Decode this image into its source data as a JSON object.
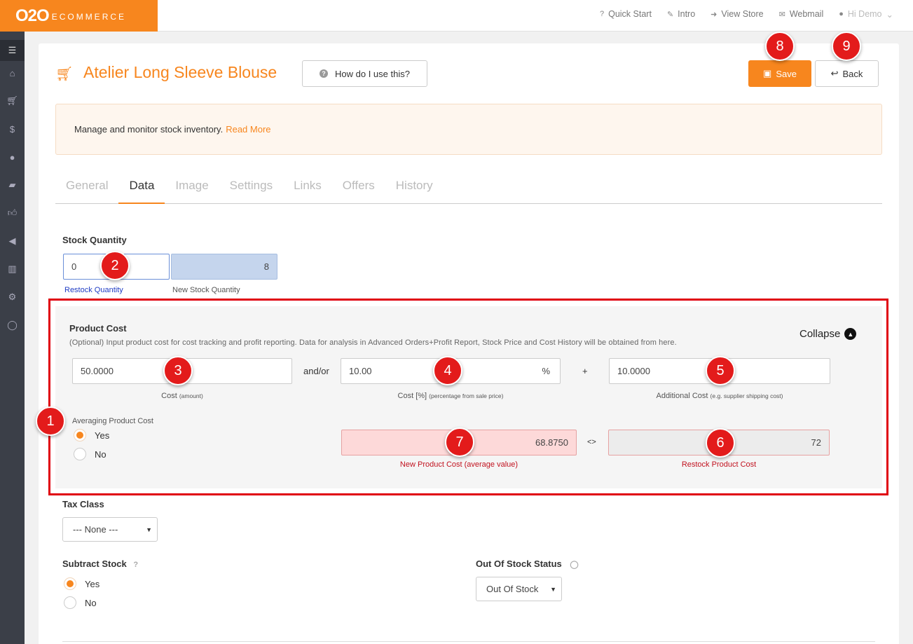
{
  "brand": {
    "main": "O2O",
    "sub": "ECOMMERCE"
  },
  "topnav": {
    "quick_start": "Quick Start",
    "intro": "Intro",
    "view_store": "View Store",
    "webmail": "Webmail",
    "user": "Hi Demo"
  },
  "header": {
    "title": "Atelier Long Sleeve Blouse",
    "help_label": "How do I use this?",
    "save_label": "Save",
    "back_label": "Back"
  },
  "info": {
    "text": "Manage and monitor stock inventory.",
    "link": "Read More"
  },
  "tabs": [
    {
      "label": "General",
      "active": false
    },
    {
      "label": "Data",
      "active": true
    },
    {
      "label": "Image",
      "active": false
    },
    {
      "label": "Settings",
      "active": false
    },
    {
      "label": "Links",
      "active": false
    },
    {
      "label": "Offers",
      "active": false
    },
    {
      "label": "History",
      "active": false
    }
  ],
  "stock": {
    "label": "Stock Quantity",
    "restock_value": "0",
    "restock_caption": "Restock Quantity",
    "new_value": "8",
    "new_caption": "New Stock Quantity"
  },
  "product_cost": {
    "label": "Product Cost",
    "description": "(Optional) Input product cost for cost tracking and profit reporting. Data for analysis in Advanced Orders+Profit Report, Stock Price and Cost History will be obtained from here.",
    "collapse_label": "Collapse",
    "cost_value": "50.0000",
    "cost_caption": "Cost",
    "cost_caption_small": "(amount)",
    "andor": "and/or",
    "percent_value": "10.00",
    "percent_suffix": "%",
    "percent_caption": "Cost [%]",
    "percent_caption_small": "(percentage from sale price)",
    "plus": "+",
    "additional_value": "10.0000",
    "additional_caption": "Additional Cost",
    "additional_caption_small": "(e.g. supplier shipping cost)",
    "averaging_label": "Averaging Product Cost",
    "yes": "Yes",
    "no": "No",
    "new_cost_value": "68.8750",
    "new_cost_caption": "New Product Cost (average value)",
    "compare": "<>",
    "restock_cost_value": "72",
    "restock_cost_caption": "Restock Product Cost"
  },
  "tax": {
    "label": "Tax Class",
    "value": "--- None ---"
  },
  "subtract": {
    "label": "Subtract Stock",
    "yes": "Yes",
    "no": "No"
  },
  "out_of_stock": {
    "label": "Out Of Stock Status",
    "value": "Out Of Stock"
  },
  "badges": [
    "1",
    "2",
    "3",
    "4",
    "5",
    "6",
    "7",
    "8",
    "9"
  ],
  "colors": {
    "accent": "#f7861e",
    "sidebar": "#3b3f48",
    "highlight": "#e0000e"
  }
}
